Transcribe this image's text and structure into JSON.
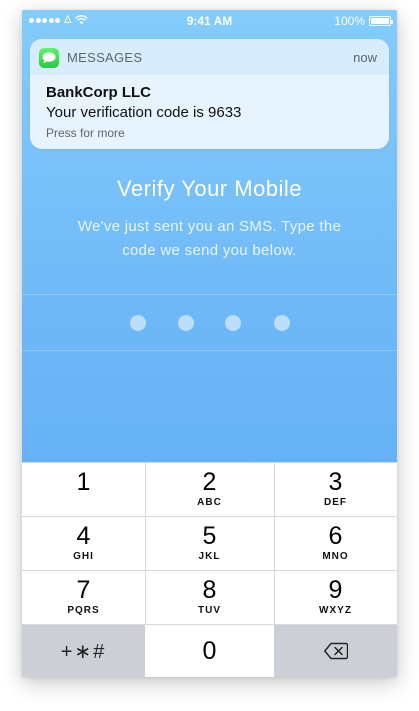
{
  "status_bar": {
    "carrier": "Δ",
    "time": "9:41 AM",
    "battery": "100%",
    "icons": [
      "signal-dots-icon",
      "wifi-icon",
      "battery-icon"
    ]
  },
  "notification": {
    "app_name": "MESSAGES",
    "time": "now",
    "sender": "BankCorp LLC",
    "body": "Your verification code is 9633",
    "hint": "Press for more",
    "icon": "messages-app-icon",
    "accent": "#27c93f"
  },
  "main": {
    "title": "Verify Your Mobile",
    "subtitle": "We've just sent you an SMS. Type the code we send you below.",
    "code_digits_entered": 0,
    "code_length": 4
  },
  "keypad": {
    "keys": [
      {
        "digit": "1",
        "letters": ""
      },
      {
        "digit": "2",
        "letters": "ABC"
      },
      {
        "digit": "3",
        "letters": "DEF"
      },
      {
        "digit": "4",
        "letters": "GHI"
      },
      {
        "digit": "5",
        "letters": "JKL"
      },
      {
        "digit": "6",
        "letters": "MNO"
      },
      {
        "digit": "7",
        "letters": "PQRS"
      },
      {
        "digit": "8",
        "letters": "TUV"
      },
      {
        "digit": "9",
        "letters": "WXYZ"
      }
    ],
    "symbols_label": "+∗#",
    "zero": "0",
    "backspace_icon": "backspace-icon"
  },
  "colors": {
    "background_top": "#84ccfb",
    "background_bottom": "#5aa8f6",
    "keypad_gray": "#ccd0d6"
  }
}
